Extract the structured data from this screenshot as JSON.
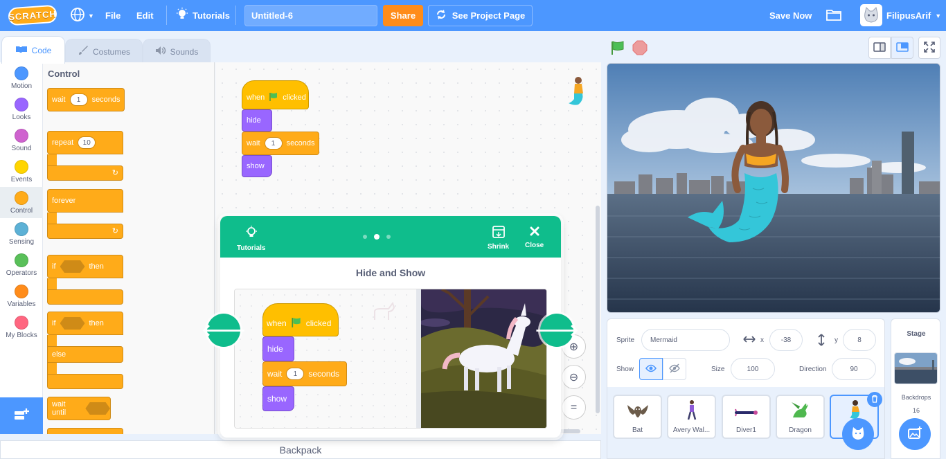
{
  "menubar": {
    "logo": "SCRATCH",
    "file": "File",
    "edit": "Edit",
    "tutorials": "Tutorials",
    "project_title": "Untitled-6",
    "share": "Share",
    "see_project_page": "See Project Page",
    "save_now": "Save Now",
    "username": "FilipusArif"
  },
  "tabs": [
    {
      "label": "Code"
    },
    {
      "label": "Costumes"
    },
    {
      "label": "Sounds"
    }
  ],
  "categories": [
    {
      "label": "Motion",
      "color": "#4c97ff"
    },
    {
      "label": "Looks",
      "color": "#9966ff"
    },
    {
      "label": "Sound",
      "color": "#cf63cf"
    },
    {
      "label": "Events",
      "color": "#ffd500"
    },
    {
      "label": "Control",
      "color": "#ffab19"
    },
    {
      "label": "Sensing",
      "color": "#5cb1d6"
    },
    {
      "label": "Operators",
      "color": "#59c059"
    },
    {
      "label": "Variables",
      "color": "#ff8c1a"
    },
    {
      "label": "My Blocks",
      "color": "#ff6680"
    }
  ],
  "palette": {
    "title": "Control",
    "wait": {
      "a": "wait",
      "value": "1",
      "b": "seconds"
    },
    "repeat": {
      "a": "repeat",
      "value": "10"
    },
    "forever": "forever",
    "if_then": {
      "a": "if",
      "b": "then"
    },
    "if_else": {
      "a": "if",
      "b": "then",
      "else": "else"
    },
    "wait_until": "wait until"
  },
  "script": {
    "when": "when",
    "clicked": "clicked",
    "hide": "hide",
    "wait": "wait",
    "wait_value": "1",
    "seconds": "seconds",
    "show": "show"
  },
  "backpack": "Backpack",
  "tutorial": {
    "tutorials_label": "Tutorials",
    "shrink_label": "Shrink",
    "close_label": "Close",
    "title": "Hide and Show",
    "step": 2,
    "steps": 3,
    "video_script": {
      "when": "when",
      "clicked": "clicked",
      "hide": "hide",
      "wait": "wait",
      "wait_value": "1",
      "seconds": "seconds",
      "show": "show"
    }
  },
  "sprite_info": {
    "sprite_label": "Sprite",
    "sprite_name": "Mermaid",
    "x_label": "x",
    "x": "-38",
    "y_label": "y",
    "y": "8",
    "show_label": "Show",
    "size_label": "Size",
    "size": "100",
    "direction_label": "Direction",
    "direction": "90"
  },
  "sprites": [
    {
      "name": "Bat"
    },
    {
      "name": "Avery Wal..."
    },
    {
      "name": "Diver1"
    },
    {
      "name": "Dragon"
    },
    {
      "name": "M",
      "selected": true
    }
  ],
  "stage_panel": {
    "label": "Stage",
    "backdrops_label": "Backdrops",
    "backdrops_count": "16"
  }
}
